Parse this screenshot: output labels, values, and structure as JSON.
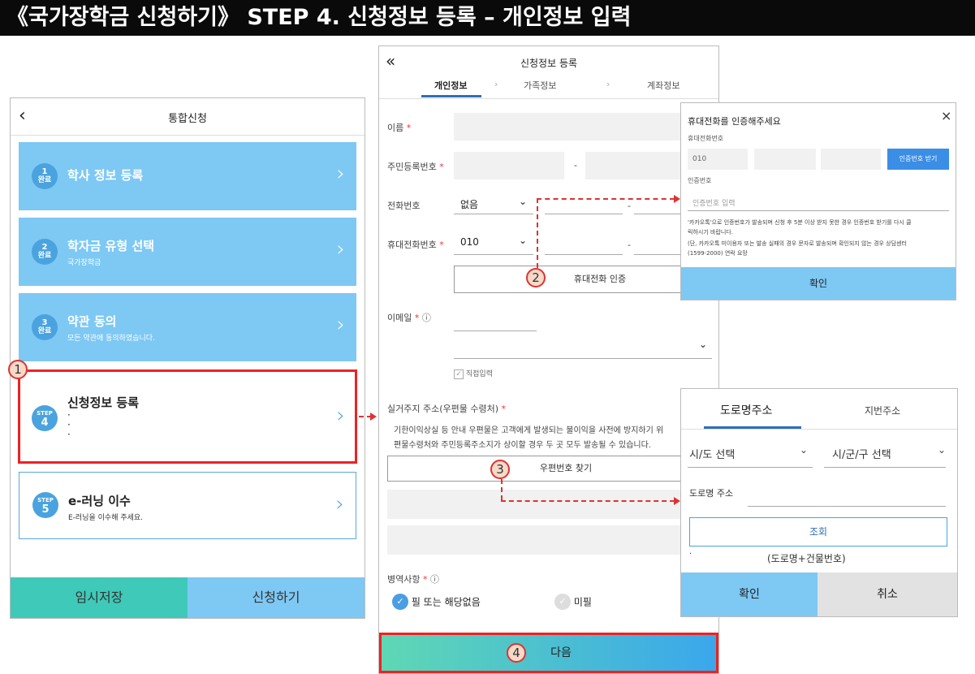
{
  "title": "《국가장학금 신청하기》 STEP 4. 신청정보 등록 – 개인정보 입력",
  "phone1": {
    "back_icon": "‹",
    "title": "통합신청",
    "cards": [
      {
        "badge_num": "1",
        "badge_text": "완료",
        "title": "학사 정보 등록",
        "sub": ""
      },
      {
        "badge_num": "2",
        "badge_text": "완료",
        "title": "학자금 유형 선택",
        "sub": "국가장학금"
      },
      {
        "badge_num": "3",
        "badge_text": "완료",
        "title": "약관 동의",
        "sub": "모든 약관에 동의하였습니다."
      },
      {
        "badge_num": "4",
        "badge_text": "STEP",
        "title": "신청정보 등록",
        "sub": "·\n·\n·"
      },
      {
        "badge_num": "5",
        "badge_text": "STEP",
        "title": "e-러닝 이수",
        "sub": "E-러닝을 이수해 주세요."
      }
    ],
    "save_label": "임시저장",
    "apply_label": "신청하기"
  },
  "markers": {
    "m1": "1",
    "m2": "2",
    "m3": "3",
    "m4": "4"
  },
  "phone2": {
    "back_icon": "«",
    "title": "신청정보 등록",
    "tabs": [
      "개인정보",
      "가족정보",
      "계좌정보"
    ],
    "tab_sep": "›",
    "name_label": "이름",
    "rrn_label": "주민등록번호",
    "rrn_dash": "-",
    "phone_label": "전화번호",
    "phone_value": "없음",
    "phone_dash": "-",
    "mobile_label": "휴대전화번호",
    "mobile_value": "010",
    "mobile_dash": "-",
    "mobile_auth_btn": "휴대전화 인증",
    "email_label": "이메일",
    "email_direct": "직접입력",
    "address_label": "실거주지 주소(우편물 수령처)",
    "address_note1": "기한이익상실 등 안내 우편물은 고객에게 발생되는 불이익을 사전에 방지하기 위",
    "address_note2": "편물수령처와 주민등록주소지가 상이할 경우 두 곳 모두 발송될 수 있습니다.",
    "zip_btn": "우편번호 찾기",
    "military_label": "병역사항",
    "military_opt1": "필 또는 해당없음",
    "military_opt2": "미필",
    "next_label": "다음",
    "req_mark": "*",
    "info_icon": "ⓘ"
  },
  "popup_phone": {
    "title": "휴대전화를 인증해주세요",
    "close": "×",
    "number_label": "휴대전화번호",
    "prefix": "010",
    "get_code_btn": "인증번호 받기",
    "code_label": "인증번호",
    "code_placeholder": "인증번호 입력",
    "note1": "'카카오톡'으로 인증번호가 발송되며 신청 후 5분 이상 받지 못한 경우 인증번호 받기를 다시 클",
    "note2": "릭하시기 바랍니다.",
    "note3": "(단, 카카오톡 미이용자 또는 발송 실패의 경우 문자로 발송되며 확인되지 않는 경우 상담센터",
    "note4": "(1599-2000) 연락 요망",
    "confirm": "확인"
  },
  "popup_addr": {
    "tab_road": "도로명주소",
    "tab_lot": "지번주소",
    "sido": "시/도 선택",
    "sigungu": "시/군/구 선택",
    "road_label": "도로명 주소",
    "search_btn": "조회",
    "dot": "·",
    "hint": "(도로명+건물번호)",
    "confirm": "확인",
    "cancel": "취소"
  },
  "colors": {
    "red": "#e22222",
    "blue": "#7ec8f4",
    "teal": "#3fc9b8",
    "dark_blue": "#2f6fb7"
  }
}
